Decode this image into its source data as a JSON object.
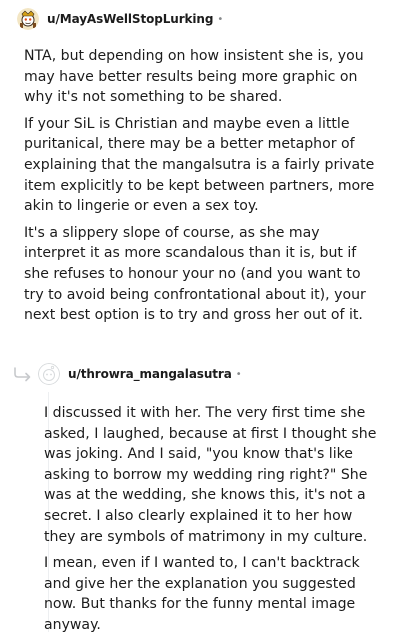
{
  "comment1": {
    "username": "u/MayAsWellStopLurking",
    "dot": "•",
    "paragraphs": [
      "NTA, but depending on how insistent she is, you may have better results being more graphic on why it's not something to be shared.",
      "If your SiL is Christian and maybe even a little puritanical, there may be a better metaphor of explaining that the mangalsutra is a fairly private item explicitly to be kept between partners, more akin to lingerie or even a sex toy.",
      "It's a slippery slope of course, as she may interpret it as more scandalous than it is, but if she refuses to honour your no (and you want to try to avoid being confrontational about it), your next best option is to try and gross her out of it."
    ]
  },
  "comment2": {
    "username": "u/throwra_mangalasutra",
    "dot": "•",
    "paragraphs": [
      "I discussed it with her. The very first time she asked, I laughed, because at first I thought she was joking. And I said, \"you know that's like asking to borrow my wedding ring right?\" She was at the wedding, she knows this, it's not a secret. I also clearly explained it to her how they are symbols of matrimony in my culture.",
      "I mean, even if I wanted to, I can't backtrack and give her the explanation you suggested now. But thanks for the funny mental image anyway."
    ]
  },
  "icons": {
    "avatar1": "snoo-avatar-icon",
    "avatar2": "default-avatar-icon",
    "reply": "reply-arrow-icon"
  }
}
